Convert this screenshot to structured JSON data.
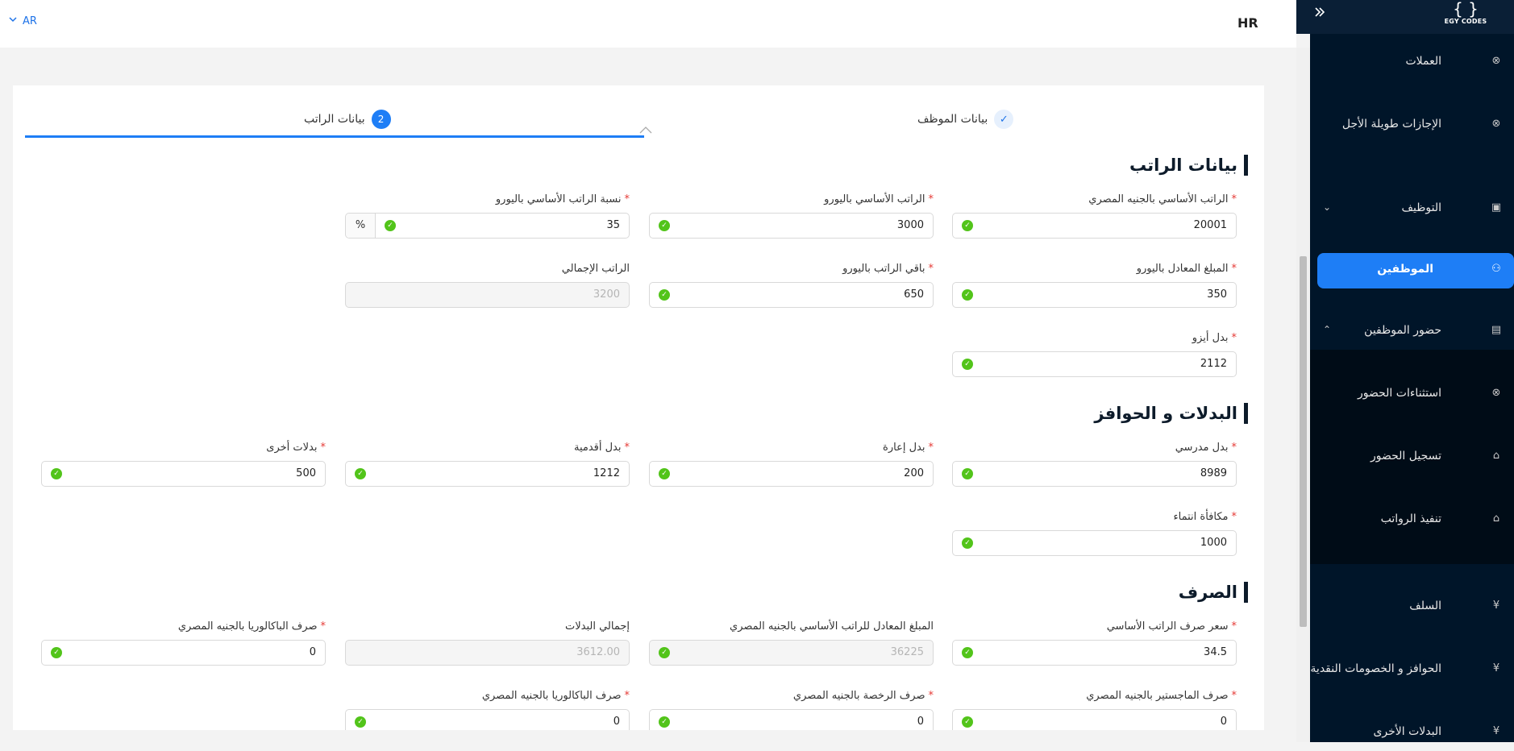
{
  "topbar": {
    "lang": "AR",
    "title": "HR"
  },
  "logo": {
    "symbol": "{ }",
    "text": "EGY CODES"
  },
  "sidebar": {
    "items": [
      {
        "label": "العملات",
        "icon": "close-circle-icon"
      },
      {
        "label": "الإجازات طويلة الأجل",
        "icon": "close-circle-icon"
      },
      {
        "label": "التوظيف",
        "icon": "id-card-icon"
      },
      {
        "label": "الموظفين",
        "icon": "users-icon"
      },
      {
        "label": "حضور الموظفين",
        "icon": "calendar-icon"
      },
      {
        "label": "استثناءات الحضور",
        "icon": "close-circle-icon"
      },
      {
        "label": "تسجيل الحضور",
        "icon": "bank-icon"
      },
      {
        "label": "تنفيذ الرواتب",
        "icon": "bank-icon"
      },
      {
        "label": "السلف",
        "icon": "yen-icon"
      },
      {
        "label": "الحوافز و الخصومات النقدية",
        "icon": "yen-icon"
      },
      {
        "label": "البدلات الأخرى",
        "icon": "yen-icon"
      }
    ]
  },
  "steps": [
    {
      "label": "بيانات الموظف",
      "state": "done"
    },
    {
      "label": "بيانات الراتب",
      "number": "2",
      "state": "active"
    }
  ],
  "sections": {
    "salary": "بيانات الراتب",
    "allowances": "البدلات و الحوافز",
    "exchange": "الصرف"
  },
  "fields": {
    "basic_egp": {
      "label": "الراتب الأساسي بالجنيه المصري",
      "value": "20001"
    },
    "basic_eur": {
      "label": "الراتب الأساسي باليورو",
      "value": "3000"
    },
    "basic_eur_pct": {
      "label": "نسبة الراتب الأساسي باليورو",
      "value": "35",
      "addon": "%"
    },
    "equiv_eur": {
      "label": "المبلغ المعادل باليورو",
      "value": "350"
    },
    "rest_eur": {
      "label": "باقي الراتب باليورو",
      "value": "650"
    },
    "total_salary": {
      "label": "الراتب الإجمالي",
      "value": "3200"
    },
    "iso_allowance": {
      "label": "بدل أيزو",
      "value": "2112"
    },
    "teacher_allowance": {
      "label": "بدل مدرسي",
      "value": "8989"
    },
    "loan_allowance": {
      "label": "بدل إعارة",
      "value": "200"
    },
    "seniority_allowance": {
      "label": "بدل أقدمية",
      "value": "1212"
    },
    "other_allowances": {
      "label": "بدلات أخرى",
      "value": "500"
    },
    "loyalty_bonus": {
      "label": "مكافأة انتماء",
      "value": "1000"
    },
    "basic_rate": {
      "label": "سعر صرف الراتب الأساسي",
      "value": "34.5"
    },
    "basic_equiv_egp": {
      "label": "المبلغ المعادل للراتب الأساسي بالجنيه المصري",
      "value": "36225"
    },
    "total_allowances": {
      "label": "إجمالي البدلات",
      "value": "3612.00"
    },
    "bacc_egp_1": {
      "label": "صرف الباكالوريا بالجنيه المصري",
      "value": "0"
    },
    "masters_egp": {
      "label": "صرف الماجستير بالجنيه المصري",
      "value": "0"
    },
    "license_egp": {
      "label": "صرف الرخصة بالجنيه المصري",
      "value": "0"
    },
    "bacc_egp_2": {
      "label": "صرف الباكالوريا بالجنيه المصري",
      "value": "0"
    }
  }
}
